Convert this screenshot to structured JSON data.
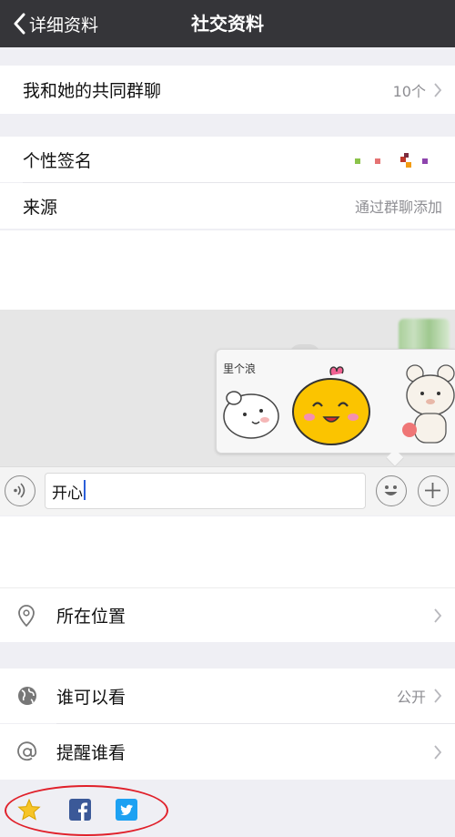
{
  "navbar": {
    "back_label": "详细资料",
    "title": "社交资料"
  },
  "groups": {
    "label": "我和她的共同群聊",
    "value": "10个"
  },
  "signature": {
    "label": "个性签名"
  },
  "source": {
    "label": "来源",
    "value": "通过群聊添加"
  },
  "sticker_popup": {
    "caption": "里个浪"
  },
  "chat_input": {
    "text": "开心"
  },
  "location": {
    "label": "所在位置"
  },
  "visibility": {
    "label": "谁可以看",
    "value": "公开"
  },
  "mention": {
    "label": "提醒谁看"
  },
  "icons": {
    "back": "chevron-left-icon",
    "chevron": "chevron-right-icon",
    "voice": "voice-icon",
    "emoji": "emoji-icon",
    "plus": "plus-icon",
    "location": "location-pin-icon",
    "globe": "globe-icon",
    "at": "at-icon",
    "star": "star-icon",
    "facebook": "facebook-icon",
    "twitter": "twitter-icon"
  },
  "colors": {
    "navbar": "#353539",
    "highlight": "#e0202a",
    "caret": "#2b5fd9",
    "facebook": "#3b5998",
    "twitter": "#1da1f2",
    "star": "#f6c428"
  }
}
